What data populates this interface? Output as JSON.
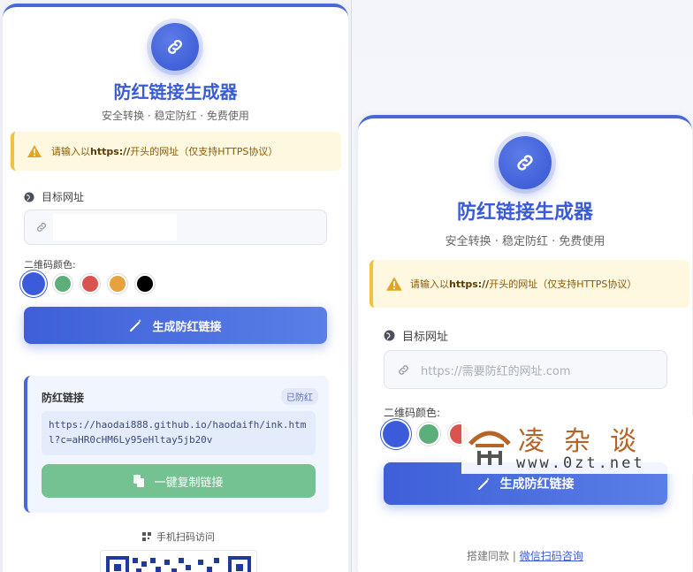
{
  "app": {
    "title": "防红链接生成器",
    "subtitle": "安全转换 · 稳定防红 · 免费使用"
  },
  "alert": {
    "prefix": "请输入以 ",
    "highlight": "https://",
    "suffix": " 开头的网址（仅支持HTTPS协议）"
  },
  "form": {
    "url_label": "目标网址",
    "url_placeholder": "https://需要防红的网址.com",
    "color_label": "二维码颜色:",
    "colors": [
      "#3b5bdb",
      "#5cae7a",
      "#d9534f",
      "#e6a23c",
      "#000000"
    ],
    "generate_label": "生成防红链接"
  },
  "result": {
    "title": "防红链接",
    "badge": "已防红",
    "link": "https://haodai888.github.io/haodaifh/ink.html?c=aHR0cHM6Ly95eHltay5jb20v",
    "copy_label": "一键复制链接"
  },
  "qr": {
    "label": "手机扫码访问"
  },
  "footer": {
    "text": "搭建同款 |",
    "link": "微信扫码咨询"
  },
  "watermark": {
    "text": "凌杂谈",
    "url": "www.0zt.net"
  }
}
